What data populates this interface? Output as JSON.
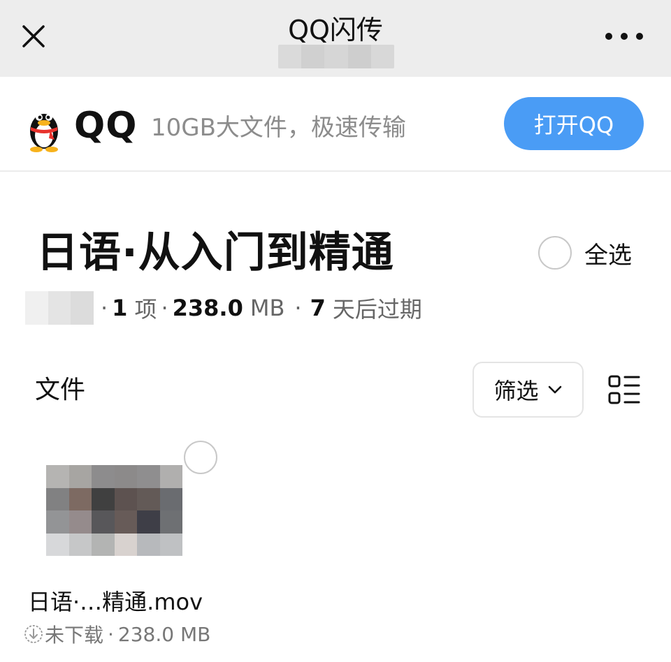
{
  "nav": {
    "title": "QQ闪传",
    "close_icon": "close-icon",
    "more_icon": "more-dots-icon",
    "sub_blur_colors": [
      "#dadada",
      "#d0d0d0",
      "#d6d6d6",
      "#cecece",
      "#d8d8d8"
    ]
  },
  "banner": {
    "logo_icon": "qq-penguin-icon",
    "brand": "QQ",
    "tagline": "10GB大文件，极速传输",
    "open_button": "打开QQ",
    "accent_color": "#4a9cf5"
  },
  "share": {
    "title": "日语·从入门到精通",
    "select_all_label": "全选",
    "meta": {
      "sender_blur_colors": [
        "#f0f0f0",
        "#e4e4e4",
        "#dcdcdc"
      ],
      "count_value": "1",
      "count_unit": "项",
      "size_value": "238.0",
      "size_unit": "MB",
      "expire_value": "7",
      "expire_text": "天后过期"
    }
  },
  "files_section": {
    "label": "文件",
    "filter_label": "筛选",
    "filter_icon": "chevron-down-icon",
    "view_toggle_icon": "list-view-icon"
  },
  "files": [
    {
      "name": "日语·…精通.mov",
      "status_icon": "download-icon",
      "status": "未下载",
      "size": "238.0 MB",
      "thumb_colors": [
        "#b5b4b2",
        "#a7a5a2",
        "#8d8c8d",
        "#8c8a8a",
        "#8f8e8f",
        "#b0afae",
        "#818182",
        "#7d6a62",
        "#404040",
        "#5d5250",
        "#635a57",
        "#6a6c70",
        "#939496",
        "#958b8c",
        "#58575a",
        "#675b58",
        "#3e3e47",
        "#6e7073",
        "#d7d8da",
        "#c6c7c8",
        "#b3b4b3",
        "#d8d2cf",
        "#b7b9bc",
        "#bfc1c3"
      ]
    }
  ]
}
